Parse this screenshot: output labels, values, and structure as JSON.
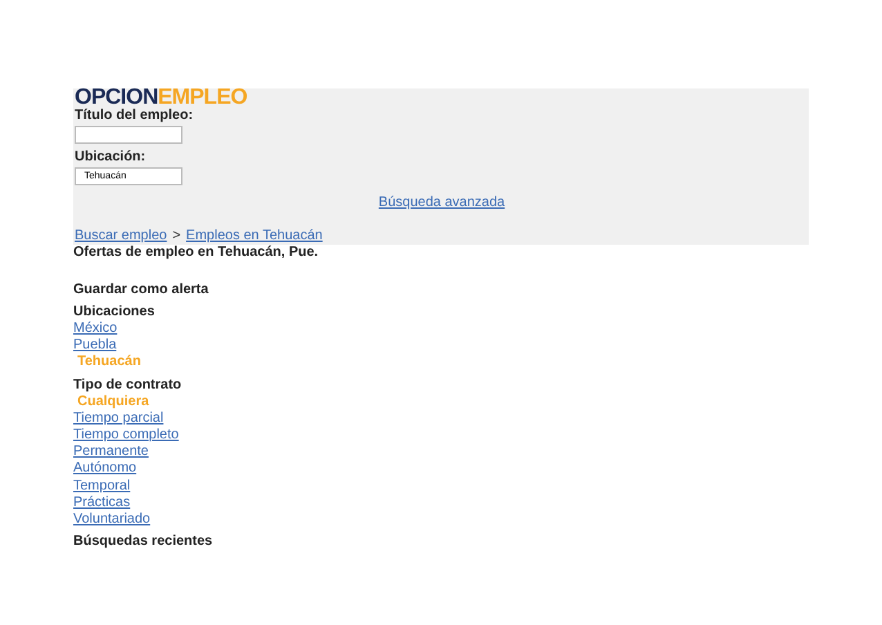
{
  "logo": {
    "part_1": "OPCION",
    "part_2": "EMPLEO"
  },
  "search": {
    "title_label": "Título del empleo:",
    "location_label": "Ubicación:",
    "location_value": "Tehuacán",
    "advanced_link": "Búsqueda avanzada"
  },
  "breadcrumbs": [
    {
      "label": "Buscar empleo"
    },
    {
      "label": "Empleos en Tehuacán"
    }
  ],
  "breadcrumb_separator": ">",
  "heading": "Ofertas de empleo en Tehuacán, Pue.",
  "save_alert": "Guardar como alerta",
  "filters": [
    {
      "title": "Ubicaciones",
      "items": [
        {
          "label": "México",
          "selected": false
        },
        {
          "label": "Puebla",
          "selected": false
        },
        {
          "label": "Tehuacán",
          "selected": true
        }
      ]
    },
    {
      "title": "Tipo de contrato",
      "items": [
        {
          "label": "Cualquiera",
          "selected": true
        },
        {
          "label": "Tiempo parcial",
          "selected": false
        },
        {
          "label": "Tiempo completo",
          "selected": false
        },
        {
          "label": "Permanente",
          "selected": false
        },
        {
          "label": "Autónomo",
          "selected": false
        },
        {
          "label": "Temporal",
          "selected": false
        },
        {
          "label": "Prácticas",
          "selected": false
        },
        {
          "label": "Voluntariado",
          "selected": false
        }
      ]
    }
  ],
  "recent_searches": "Búsquedas recientes"
}
